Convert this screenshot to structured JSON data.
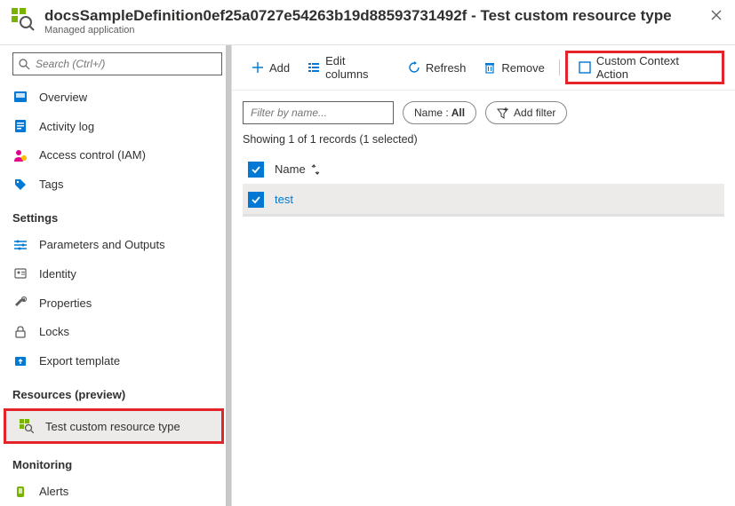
{
  "header": {
    "title": "docsSampleDefinition0ef25a0727e54263b19d88593731492f - Test custom resource type",
    "subtitle": "Managed application"
  },
  "search": {
    "placeholder": "Search (Ctrl+/)"
  },
  "sidebar": {
    "group_top": [
      {
        "label": "Overview",
        "id": "overview"
      },
      {
        "label": "Activity log",
        "id": "activity-log"
      },
      {
        "label": "Access control (IAM)",
        "id": "access-control"
      },
      {
        "label": "Tags",
        "id": "tags"
      }
    ],
    "heading_settings": "Settings",
    "group_settings": [
      {
        "label": "Parameters and Outputs",
        "id": "parameters-outputs"
      },
      {
        "label": "Identity",
        "id": "identity"
      },
      {
        "label": "Properties",
        "id": "properties"
      },
      {
        "label": "Locks",
        "id": "locks"
      },
      {
        "label": "Export template",
        "id": "export-template"
      }
    ],
    "heading_resources": "Resources (preview)",
    "group_resources": [
      {
        "label": "Test custom resource type",
        "id": "test-custom-resource-type",
        "active": true
      }
    ],
    "heading_monitoring": "Monitoring",
    "group_monitoring": [
      {
        "label": "Alerts",
        "id": "alerts"
      }
    ]
  },
  "toolbar": {
    "add": "Add",
    "edit_columns": "Edit columns",
    "refresh": "Refresh",
    "remove": "Remove",
    "custom_action": "Custom Context Action"
  },
  "filters": {
    "filter_placeholder": "Filter by name...",
    "name_pill_prefix": "Name :",
    "name_pill_value": "All",
    "add_filter": "Add filter"
  },
  "records_text": "Showing 1 of 1 records (1 selected)",
  "table": {
    "column_name": "Name",
    "rows": [
      {
        "name": "test"
      }
    ]
  }
}
